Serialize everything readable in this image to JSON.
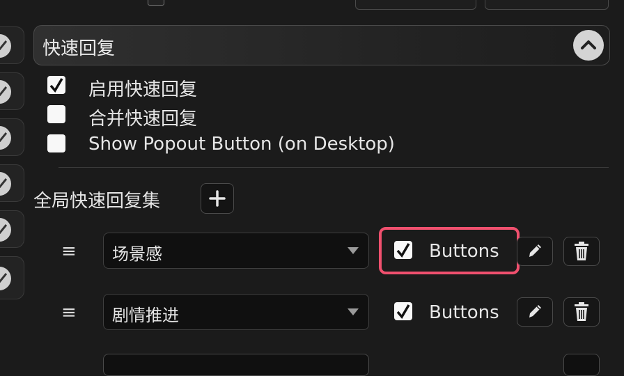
{
  "section": {
    "title": "快速回复",
    "collapse_icon": "chevron-up-icon"
  },
  "options": [
    {
      "label": "启用快速回复",
      "checked": true
    },
    {
      "label": "合并快速回复",
      "checked": false
    },
    {
      "label": "Show Popout Button (on Desktop)",
      "checked": false
    }
  ],
  "global_sets": {
    "title": "全局快速回复集",
    "add_icon": "plus-icon"
  },
  "rows": [
    {
      "drag": "≡",
      "value": "场景感",
      "buttons_label": "Buttons",
      "buttons_checked": true,
      "highlighted": true
    },
    {
      "drag": "≡",
      "value": "剧情推进",
      "buttons_label": "Buttons",
      "buttons_checked": true,
      "highlighted": false
    }
  ],
  "colors": {
    "highlight": "#f0506e",
    "background": "#1b1b1b"
  }
}
